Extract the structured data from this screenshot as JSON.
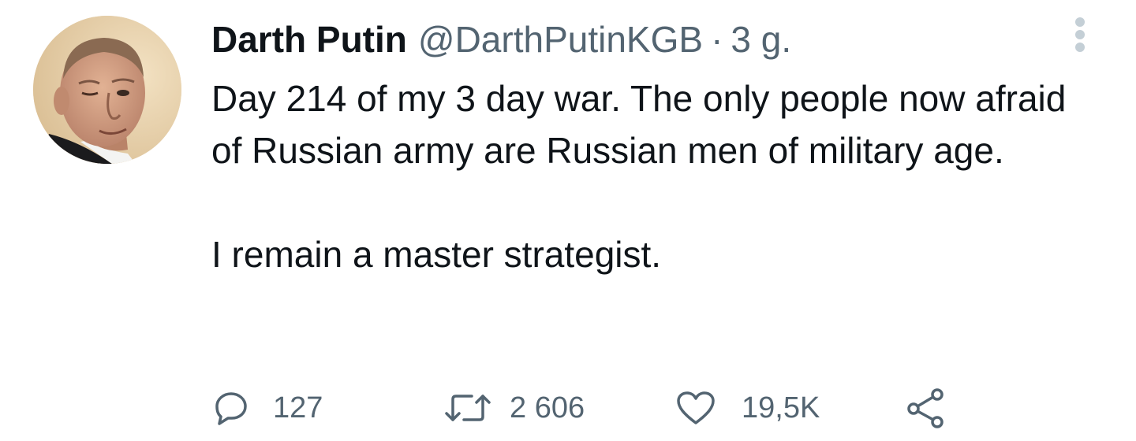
{
  "tweet": {
    "display_name": "Darth Putin",
    "handle": "@DarthPutinKGB",
    "separator": "·",
    "time": "3 g.",
    "text_lines": [
      "Day 214 of my 3 day war. The only people now afraid of Russian army are Russian men of military age.",
      "I remain a master strategist."
    ],
    "avatar_icon": "profile-photo"
  },
  "actions": {
    "reply": {
      "icon": "reply-icon",
      "count": "127"
    },
    "retweet": {
      "icon": "retweet-icon",
      "count": "2 606"
    },
    "like": {
      "icon": "heart-icon",
      "count": "19,5K"
    },
    "share": {
      "icon": "share-icon"
    }
  },
  "colors": {
    "text_primary": "#0f1419",
    "text_secondary": "#536471",
    "more_dots": "#c4cfd6"
  }
}
